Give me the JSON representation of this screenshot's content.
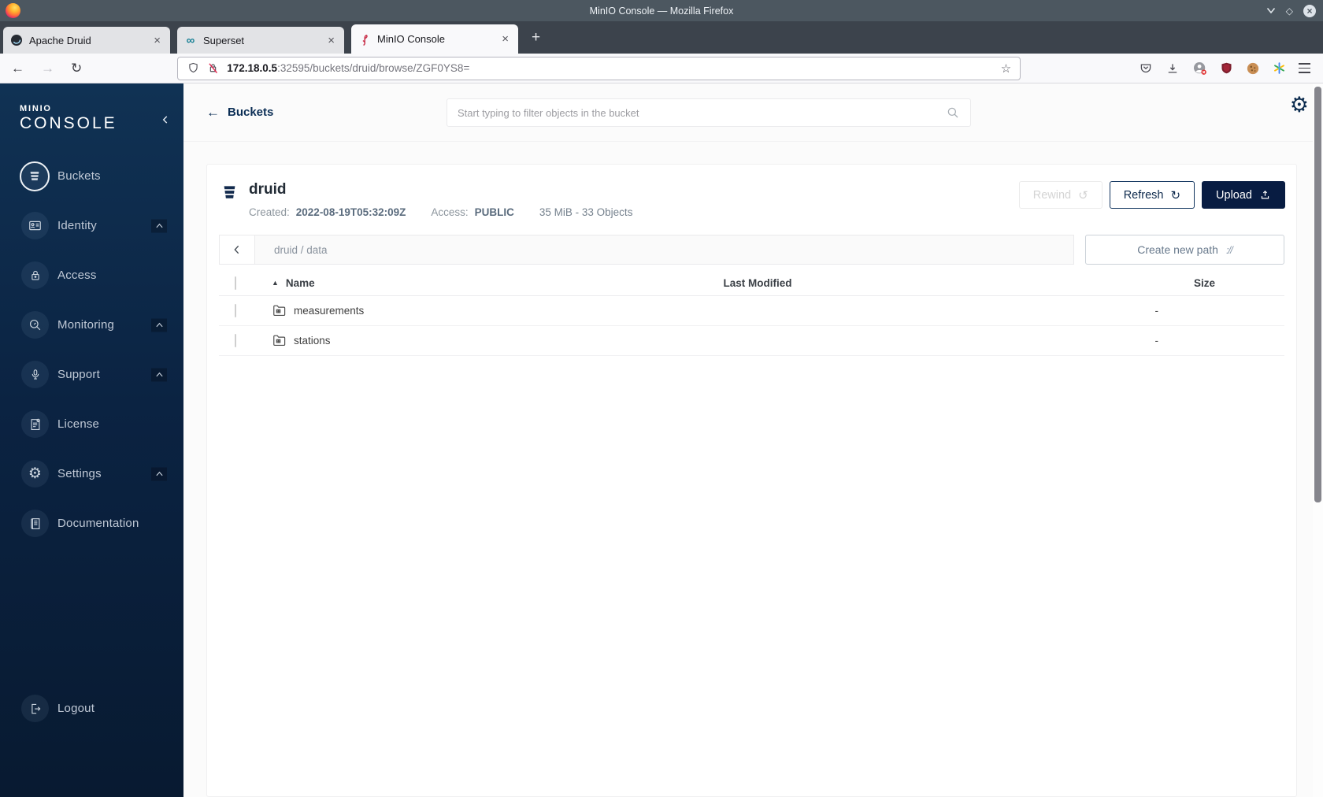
{
  "colors": {
    "accent_navy": "#081C42",
    "sidebar_gradient_top": "#103254",
    "sidebar_gradient_bottom": "#081a31",
    "upload_button_bg": "#081C42",
    "insecure_red": "#e5254f"
  },
  "icons": {
    "maximize_glyph": "◇",
    "close_glyph": "×",
    "back_glyph": "←",
    "forward_glyph": "→",
    "reload_glyph": "↻",
    "star_glyph": "☆",
    "gear_glyph": "⚙",
    "sort_asc_glyph": "▲",
    "rewind_glyph": "↺",
    "infinity_glyph": "∞"
  },
  "window": {
    "title": "MinIO Console — Mozilla Firefox",
    "new_tab": "+",
    "tabs": [
      {
        "label": "Apache Druid",
        "close": "×"
      },
      {
        "label": "Superset",
        "close": "×"
      },
      {
        "label": "MinIO Console",
        "close": "×"
      }
    ]
  },
  "toolbar": {
    "url_host": "172.18.0.5",
    "url_rest": ":32595/buckets/druid/browse/ZGF0YS8="
  },
  "sidebar": {
    "logo_line1": "MINIO",
    "logo_line2": "CONSOLE",
    "items": [
      {
        "label": "Buckets"
      },
      {
        "label": "Identity"
      },
      {
        "label": "Access"
      },
      {
        "label": "Monitoring"
      },
      {
        "label": "Support"
      },
      {
        "label": "License"
      },
      {
        "label": "Settings"
      },
      {
        "label": "Documentation"
      }
    ],
    "logout_label": "Logout"
  },
  "main": {
    "header": {
      "back_arrow": "←",
      "back_label": "Buckets",
      "search_placeholder": "Start typing to filter objects in the bucket"
    },
    "bucket": {
      "name": "druid",
      "created_label": "Created:",
      "created_value": "2022-08-19T05:32:09Z",
      "access_label": "Access:",
      "access_value": "PUBLIC",
      "summary": "35 MiB - 33 Objects",
      "rewind_label": "Rewind",
      "refresh_label": "Refresh",
      "upload_label": "Upload"
    },
    "browse": {
      "path": "druid / data",
      "create_path_label": "Create new path",
      "create_path_icon": "://",
      "table": {
        "col_name": "Name",
        "col_modified": "Last Modified",
        "col_size": "Size",
        "rows": [
          {
            "name": "measurements",
            "last_modified": "",
            "size": "-"
          },
          {
            "name": "stations",
            "last_modified": "",
            "size": "-"
          }
        ]
      }
    }
  }
}
